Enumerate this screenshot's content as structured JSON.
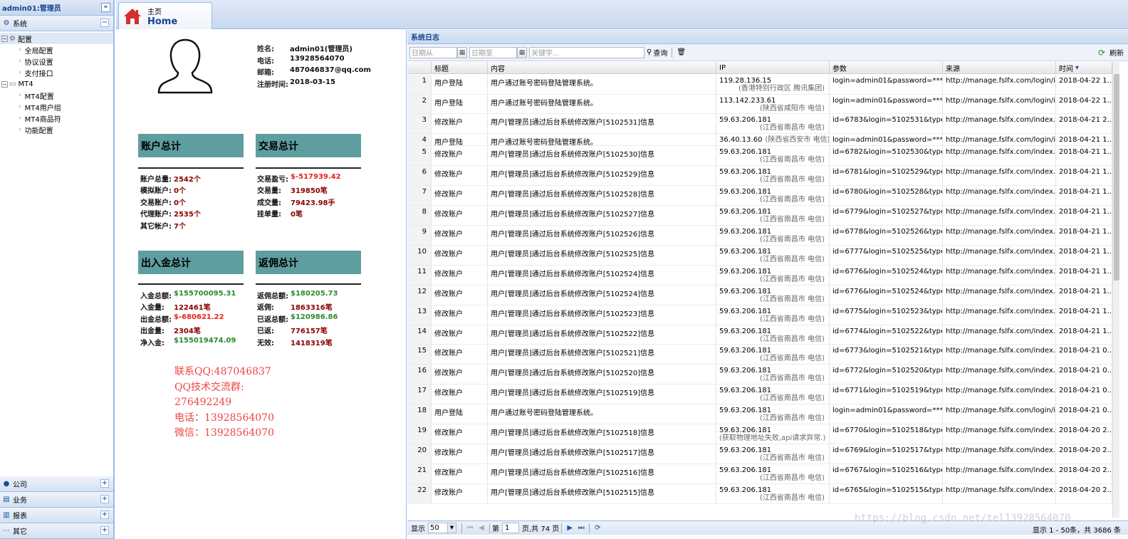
{
  "sidebar": {
    "user_title": "admin01:管理员",
    "collapse_glyph": "«",
    "system_label": "系统",
    "system_toggle": "−",
    "tree": {
      "config_label": "配置",
      "config_children": [
        "全局配置",
        "协议设置",
        "支付接口"
      ],
      "mt4_label": "MT4",
      "mt4_children": [
        "MT4配置",
        "MT4用户组",
        "MT4商品符",
        "功能配置"
      ]
    },
    "bottom_sections": [
      "公司",
      "业务",
      "报表",
      "其它"
    ],
    "bottom_toggle": "+"
  },
  "tabbar": {
    "home_cn": "主页",
    "home_en": "Home",
    "home_color": "#d32f2f"
  },
  "profile": {
    "name_label": "姓名:",
    "name": "admin01(管理员)",
    "phone_label": "电话:",
    "phone": "13928564070",
    "email_label": "邮箱:",
    "email": "487046837@qq.com",
    "reg_label": "注册时间:",
    "reg": "2018-03-15"
  },
  "accounts": {
    "title": "账户总计",
    "rows": [
      {
        "k": "账户总量:",
        "v": "2542个"
      },
      {
        "k": "模拟账户:",
        "v": "0个"
      },
      {
        "k": "交易账户:",
        "v": "0个"
      },
      {
        "k": "代理账户:",
        "v": "2535个"
      },
      {
        "k": "其它帐户:",
        "v": "7个"
      }
    ]
  },
  "trades": {
    "title": "交易总计",
    "rows": [
      {
        "k": "交易盈亏:",
        "v": "$-517939.42"
      },
      {
        "k": "交易量:",
        "v": "319850笔"
      },
      {
        "k": "成交量:",
        "v": "79423.98手"
      },
      {
        "k": "挂单量:",
        "v": "0笔"
      }
    ]
  },
  "funds": {
    "title": "出入金总计",
    "rows": [
      {
        "k": "入金总额:",
        "v": "$155700095.31"
      },
      {
        "k": "入金量:",
        "v": "122461笔"
      },
      {
        "k": "出金总额:",
        "v": "$-680621.22"
      },
      {
        "k": "出金量:",
        "v": "2304笔"
      },
      {
        "k": "净入金:",
        "v": "$155019474.09"
      }
    ]
  },
  "rebates": {
    "title": "返佣总计",
    "rows": [
      {
        "k": "返佣总额:",
        "v": "$180205.73"
      },
      {
        "k": "返佣:",
        "v": "1863316笔"
      },
      {
        "k": "已返总额:",
        "v": "$120986.86"
      },
      {
        "k": "已返:",
        "v": "776157笔"
      },
      {
        "k": "无效:",
        "v": "1418319笔"
      }
    ]
  },
  "contact": {
    "qq": "联系QQ:487046837",
    "group_label": "QQ技术交流群:",
    "group": "276492249",
    "phone": "电话：13928564070",
    "wechat": "微信：13928564070"
  },
  "log_panel": {
    "title": "系统日志",
    "date_from_placeholder": "日期从",
    "date_to_placeholder": "日期至",
    "keyword_placeholder": "关键字...",
    "search_label": "查询",
    "refresh_label": "刷新",
    "columns": [
      "标题",
      "内容",
      "IP",
      "参数",
      "来源",
      "时间"
    ],
    "sort_glyph": "▾",
    "rows": [
      {
        "n": "1",
        "title": "用户登陆",
        "content": "用户通过账号密码登陆管理系统。",
        "ip": "119.28.136.15",
        "loc": "(香港特别行政区 腾讯集团)",
        "param": "login=admin01&password=***...",
        "src": "http://manage.fslfx.com/login/i...",
        "time": "2018-04-22 1..."
      },
      {
        "n": "2",
        "title": "用户登陆",
        "content": "用户通过账号密码登陆管理系统。",
        "ip": "113.142.233.61",
        "loc": "(陕西省咸阳市 电信)",
        "param": "login=admin01&password=***...",
        "src": "http://manage.fslfx.com/login/i...",
        "time": "2018-04-22 1..."
      },
      {
        "n": "3",
        "title": "修改账户",
        "content": "用户[管理员]通过后台系统修改账户[5102531]信息",
        "ip": "59.63.206.181",
        "loc": "(江西省南昌市 电信)",
        "param": "id=6783&login=5102531&typei...",
        "src": "http://manage.fslfx.com/index....",
        "time": "2018-04-21 2..."
      },
      {
        "n": "4",
        "title": "用户登陆",
        "content": "用户通过账号密码登陆管理系统。",
        "ip": "36.40.13.60",
        "loc": "(陕西省西安市 电信)",
        "param": "login=admin01&password=***...",
        "src": "http://manage.fslfx.com/login/i...",
        "time": "2018-04-21 1...",
        "inline": true
      },
      {
        "n": "5",
        "title": "修改账户",
        "content": "用户[管理员]通过后台系统修改账户[5102530]信息",
        "ip": "59.63.206.181",
        "loc": "(江西省南昌市 电信)",
        "param": "id=6782&login=5102530&typei...",
        "src": "http://manage.fslfx.com/index....",
        "time": "2018-04-21 1..."
      },
      {
        "n": "6",
        "title": "修改账户",
        "content": "用户[管理员]通过后台系统修改账户[5102529]信息",
        "ip": "59.63.206.181",
        "loc": "(江西省南昌市 电信)",
        "param": "id=6781&login=5102529&typei...",
        "src": "http://manage.fslfx.com/index....",
        "time": "2018-04-21 1..."
      },
      {
        "n": "7",
        "title": "修改账户",
        "content": "用户[管理员]通过后台系统修改账户[5102528]信息",
        "ip": "59.63.206.181",
        "loc": "(江西省南昌市 电信)",
        "param": "id=6780&login=5102528&typei...",
        "src": "http://manage.fslfx.com/index....",
        "time": "2018-04-21 1..."
      },
      {
        "n": "8",
        "title": "修改账户",
        "content": "用户[管理员]通过后台系统修改账户[5102527]信息",
        "ip": "59.63.206.181",
        "loc": "(江西省南昌市 电信)",
        "param": "id=6779&login=5102527&typei...",
        "src": "http://manage.fslfx.com/index....",
        "time": "2018-04-21 1..."
      },
      {
        "n": "9",
        "title": "修改账户",
        "content": "用户[管理员]通过后台系统修改账户[5102526]信息",
        "ip": "59.63.206.181",
        "loc": "(江西省南昌市 电信)",
        "param": "id=6778&login=5102526&typei...",
        "src": "http://manage.fslfx.com/index....",
        "time": "2018-04-21 1..."
      },
      {
        "n": "10",
        "title": "修改账户",
        "content": "用户[管理员]通过后台系统修改账户[5102525]信息",
        "ip": "59.63.206.181",
        "loc": "(江西省南昌市 电信)",
        "param": "id=6777&login=5102525&typei...",
        "src": "http://manage.fslfx.com/index....",
        "time": "2018-04-21 1..."
      },
      {
        "n": "11",
        "title": "修改账户",
        "content": "用户[管理员]通过后台系统修改账户[5102524]信息",
        "ip": "59.63.206.181",
        "loc": "(江西省南昌市 电信)",
        "param": "id=6776&login=5102524&typei...",
        "src": "http://manage.fslfx.com/index....",
        "time": "2018-04-21 1..."
      },
      {
        "n": "12",
        "title": "修改账户",
        "content": "用户[管理员]通过后台系统修改账户[5102524]信息",
        "ip": "59.63.206.181",
        "loc": "(江西省南昌市 电信)",
        "param": "id=6776&login=5102524&typei...",
        "src": "http://manage.fslfx.com/index....",
        "time": "2018-04-21 1..."
      },
      {
        "n": "13",
        "title": "修改账户",
        "content": "用户[管理员]通过后台系统修改账户[5102523]信息",
        "ip": "59.63.206.181",
        "loc": "(江西省南昌市 电信)",
        "param": "id=6775&login=5102523&typei...",
        "src": "http://manage.fslfx.com/index....",
        "time": "2018-04-21 1..."
      },
      {
        "n": "14",
        "title": "修改账户",
        "content": "用户[管理员]通过后台系统修改账户[5102522]信息",
        "ip": "59.63.206.181",
        "loc": "(江西省南昌市 电信)",
        "param": "id=6774&login=5102522&typei...",
        "src": "http://manage.fslfx.com/index....",
        "time": "2018-04-21 1..."
      },
      {
        "n": "15",
        "title": "修改账户",
        "content": "用户[管理员]通过后台系统修改账户[5102521]信息",
        "ip": "59.63.206.181",
        "loc": "(江西省南昌市 电信)",
        "param": "id=6773&login=5102521&typei...",
        "src": "http://manage.fslfx.com/index....",
        "time": "2018-04-21 0..."
      },
      {
        "n": "16",
        "title": "修改账户",
        "content": "用户[管理员]通过后台系统修改账户[5102520]信息",
        "ip": "59.63.206.181",
        "loc": "(江西省南昌市 电信)",
        "param": "id=6772&login=5102520&typei...",
        "src": "http://manage.fslfx.com/index....",
        "time": "2018-04-21 0..."
      },
      {
        "n": "17",
        "title": "修改账户",
        "content": "用户[管理员]通过后台系统修改账户[5102519]信息",
        "ip": "59.63.206.181",
        "loc": "(江西省南昌市 电信)",
        "param": "id=6771&login=5102519&typei...",
        "src": "http://manage.fslfx.com/index....",
        "time": "2018-04-21 0..."
      },
      {
        "n": "18",
        "title": "用户登陆",
        "content": "用户通过账号密码登陆管理系统。",
        "ip": "59.63.206.181",
        "loc": "(江西省南昌市 电信)",
        "param": "login=admin01&password=***...",
        "src": "http://manage.fslfx.com/login/i...",
        "time": "2018-04-21 0..."
      },
      {
        "n": "19",
        "title": "修改账户",
        "content": "用户[管理员]通过后台系统修改账户[5102518]信息",
        "ip": "59.63.206.181",
        "loc": "(获取物理地址失败,api请求异常.)",
        "param": "id=6770&login=5102518&typei...",
        "src": "http://manage.fslfx.com/index....",
        "time": "2018-04-20 2..."
      },
      {
        "n": "20",
        "title": "修改账户",
        "content": "用户[管理员]通过后台系统修改账户[5102517]信息",
        "ip": "59.63.206.181",
        "loc": "(江西省南昌市 电信)",
        "param": "id=6769&login=5102517&typei...",
        "src": "http://manage.fslfx.com/index....",
        "time": "2018-04-20 2..."
      },
      {
        "n": "21",
        "title": "修改账户",
        "content": "用户[管理员]通过后台系统修改账户[5102516]信息",
        "ip": "59.63.206.181",
        "loc": "(江西省南昌市 电信)",
        "param": "id=6767&login=5102516&typei...",
        "src": "http://manage.fslfx.com/index....",
        "time": "2018-04-20 2..."
      },
      {
        "n": "22",
        "title": "修改账户",
        "content": "用户[管理员]通过后台系统修改账户[5102515]信息",
        "ip": "59.63.206.181",
        "loc": "(江西省南昌市 电信)",
        "param": "id=6765&login=5102515&typei...",
        "src": "http://manage.fslfx.com/index....",
        "time": "2018-04-20 2..."
      }
    ]
  },
  "pager": {
    "show_label": "显示",
    "page_size": "50",
    "page_label": "第",
    "page": "1",
    "total_pages": "页,共 74 页",
    "info": "显示 1 - 50条，共 3686 条"
  },
  "watermark": "https://blog.csdn.net/tel13928564070"
}
